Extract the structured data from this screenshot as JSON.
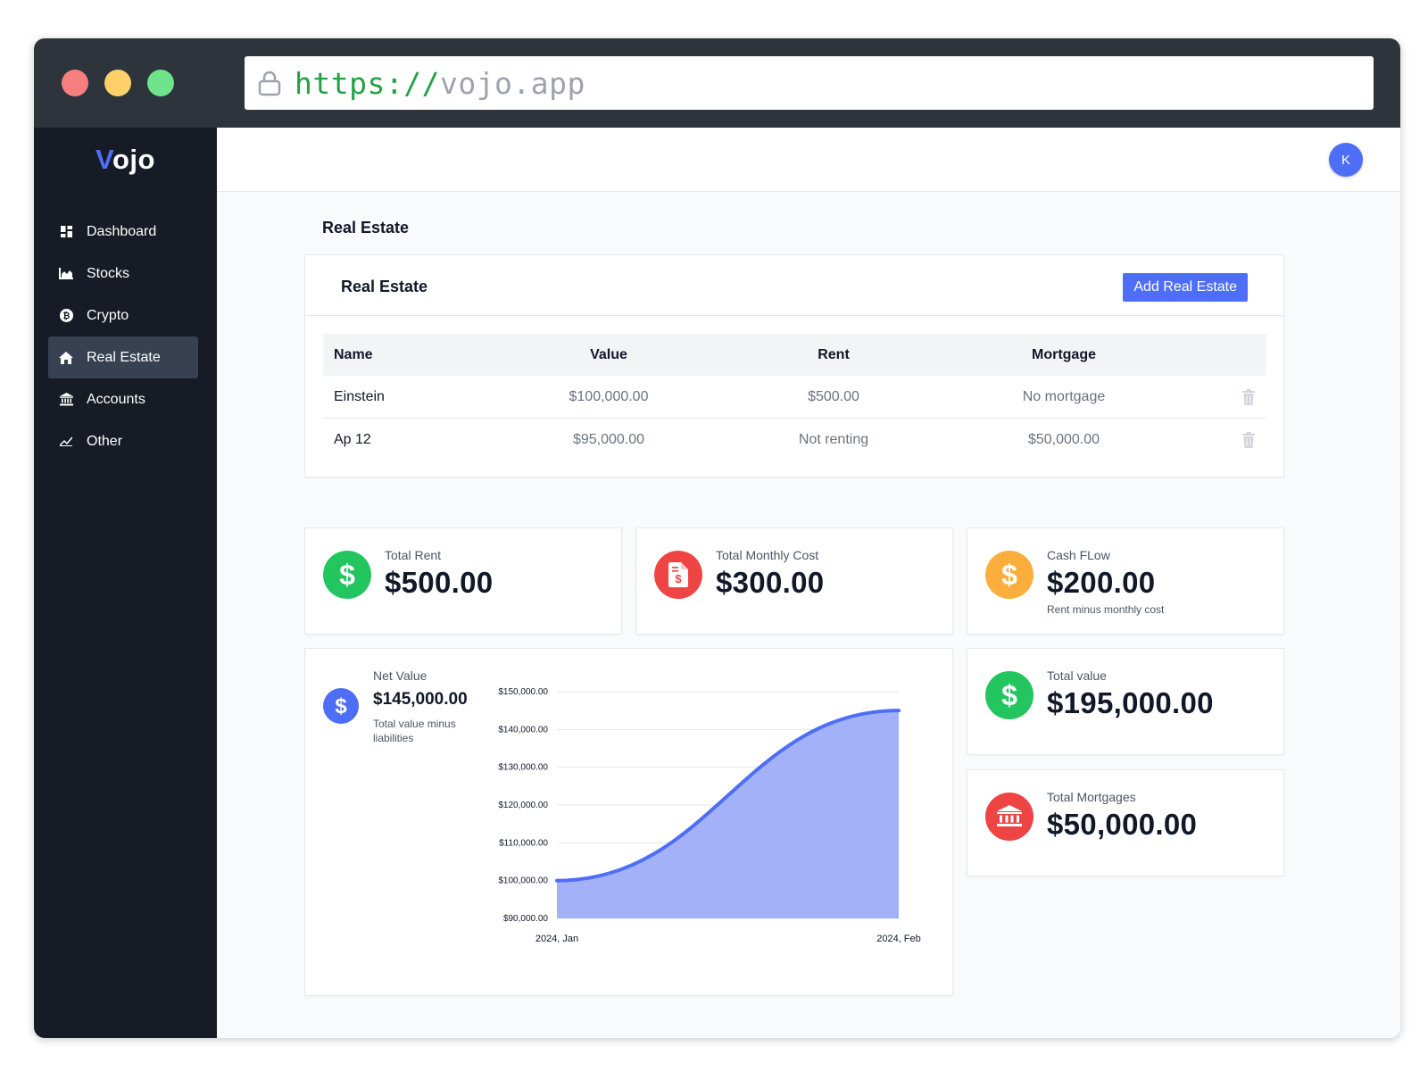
{
  "browser": {
    "url_protocol": "https://",
    "url_host": "vojo.app"
  },
  "app": {
    "logo_first": "V",
    "logo_rest": "ojo"
  },
  "sidebar": {
    "items": [
      {
        "label": "Dashboard",
        "icon": "dashboard-icon",
        "active": false
      },
      {
        "label": "Stocks",
        "icon": "chart-area-icon",
        "active": false
      },
      {
        "label": "Crypto",
        "icon": "bitcoin-icon",
        "active": false
      },
      {
        "label": "Real Estate",
        "icon": "home-icon",
        "active": true
      },
      {
        "label": "Accounts",
        "icon": "bank-icon",
        "active": false
      },
      {
        "label": "Other",
        "icon": "trend-icon",
        "active": false
      }
    ]
  },
  "header": {
    "avatar_initial": "K"
  },
  "page": {
    "title": "Real Estate"
  },
  "real_estate": {
    "card_title": "Real Estate",
    "add_button": "Add Real Estate",
    "columns": [
      "Name",
      "Value",
      "Rent",
      "Mortgage"
    ],
    "rows": [
      {
        "name": "Einstein",
        "value": "$100,000.00",
        "rent": "$500.00",
        "mortgage": "No mortgage"
      },
      {
        "name": "Ap 12",
        "value": "$95,000.00",
        "rent": "Not renting",
        "mortgage": "$50,000.00"
      }
    ]
  },
  "stats": {
    "total_rent": {
      "label": "Total Rent",
      "value": "$500.00",
      "color": "#22c55e",
      "icon": "dollar-icon"
    },
    "total_monthly_cost": {
      "label": "Total Monthly Cost",
      "value": "$300.00",
      "color": "#ef4444",
      "icon": "invoice-icon"
    },
    "cash_flow": {
      "label": "Cash FLow",
      "value": "$200.00",
      "sub": "Rent minus monthly cost",
      "color": "#fbae3c",
      "icon": "dollar-icon"
    },
    "total_value": {
      "label": "Total value",
      "value": "$195,000.00",
      "color": "#22c55e",
      "icon": "dollar-icon"
    },
    "total_mortgages": {
      "label": "Total Mortgages",
      "value": "$50,000.00",
      "color": "#ef4444",
      "icon": "bank-icon"
    }
  },
  "net_value": {
    "label": "Net Value",
    "value": "$145,000.00",
    "sub": "Total value minus liabilities",
    "color": "#4f6ef7"
  },
  "chart_data": {
    "type": "area",
    "title": "",
    "xlabel": "",
    "ylabel": "",
    "x": [
      "2024, Jan",
      "2024, Feb"
    ],
    "series": [
      {
        "values": [
          100000,
          145000
        ]
      }
    ],
    "ylim": [
      90000,
      150000
    ],
    "yticks": [
      150000,
      140000,
      130000,
      120000,
      110000,
      100000,
      90000
    ],
    "ytick_labels": [
      "$150,000.00",
      "$140,000.00",
      "$130,000.00",
      "$120,000.00",
      "$110,000.00",
      "$100,000.00",
      "$90,000.00"
    ],
    "grid": true,
    "line_color": "#4f6ef7",
    "fill_color": "#a3b2f8"
  }
}
